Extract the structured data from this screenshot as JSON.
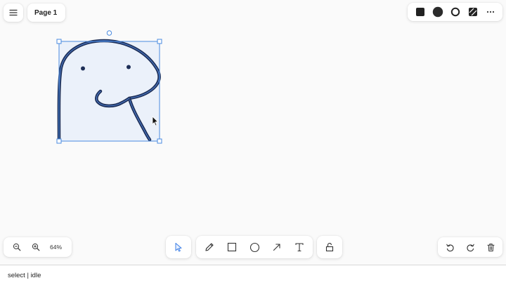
{
  "toolbar": {
    "menu_icon": "hamburger-menu-icon",
    "page_label": "Page 1"
  },
  "style_bar": {
    "items": [
      "filled-square-icon",
      "filled-circle-icon",
      "outline-circle-icon",
      "striped-fill-icon",
      "more-options-icon"
    ]
  },
  "zoom": {
    "zoom_out_icon": "zoom-out-icon",
    "zoom_in_icon": "zoom-in-icon",
    "level": "64%"
  },
  "tools": [
    "select-arrow-icon",
    "pencil-icon",
    "rectangle-icon",
    "ellipse-icon",
    "arrow-icon",
    "text-icon",
    "lock-icon"
  ],
  "history": [
    "undo-icon",
    "redo-icon",
    "trash-icon"
  ],
  "status": {
    "text": "select | idle"
  },
  "colors": {
    "background": "#fafafa",
    "selection": "#4a8be0",
    "stroke": "#1e2f57",
    "shape_fill": "#e8eff9",
    "active_tool": "#3f80e6"
  }
}
